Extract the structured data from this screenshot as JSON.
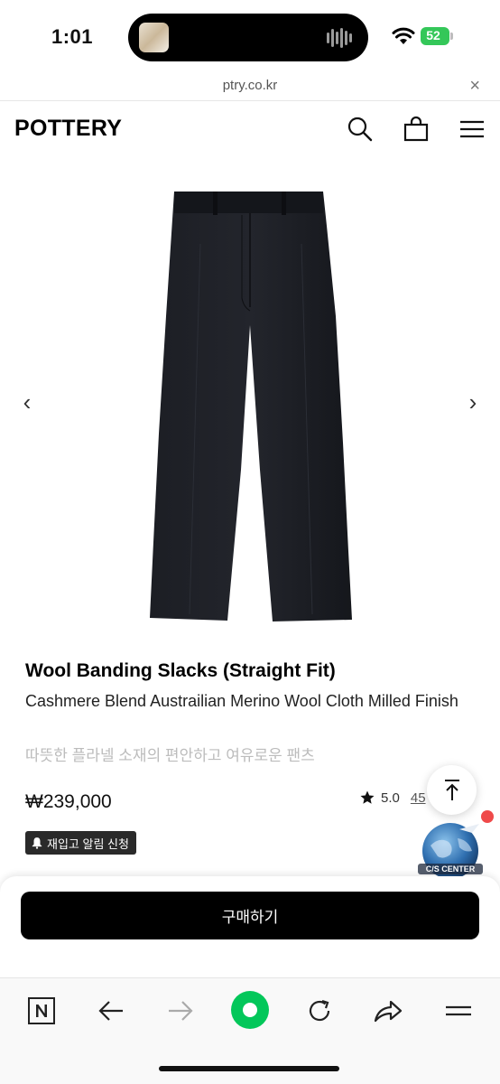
{
  "status_bar": {
    "time": "1:01",
    "battery": "52"
  },
  "browser": {
    "url": "ptry.co.kr",
    "close_symbol": "×"
  },
  "header": {
    "logo": "POTTERY",
    "icons": [
      "search-icon",
      "shopping-bag-icon",
      "menu-icon"
    ]
  },
  "gallery": {
    "prev_symbol": "‹",
    "next_symbol": "›"
  },
  "product": {
    "title": "Wool Banding Slacks (Straight Fit)",
    "subtitle": "Cashmere Blend Austrailian Merino Wool Cloth Milled Finish",
    "description": "따뜻한 플라넬 소재의 편안하고 여유로운 팬츠",
    "price": "₩239,000",
    "rating": "5.0",
    "review_count": "45",
    "restock_label": "재입고 알림 신청"
  },
  "widgets": {
    "cs_label": "C/S CENTER"
  },
  "purchase": {
    "buy_label": "구매하기"
  },
  "toolbar": {
    "icons": [
      "naver-icon",
      "back-icon",
      "forward-icon",
      "green-dot-icon",
      "reload-icon",
      "share-icon",
      "menu-icon"
    ]
  },
  "colors": {
    "accent_green": "#03c75a",
    "battery_green": "#34c759",
    "notification_red": "#ef4a4a"
  }
}
